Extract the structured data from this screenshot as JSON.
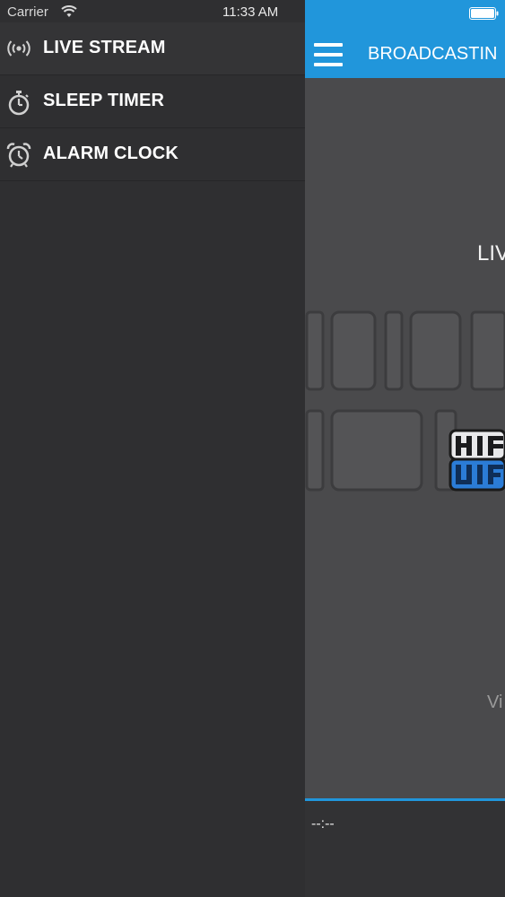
{
  "status_bar": {
    "carrier": "Carrier",
    "time": "11:33 AM"
  },
  "drawer": {
    "items": [
      {
        "label": "LIVE STREAM",
        "icon": "broadcast-icon"
      },
      {
        "label": "SLEEP TIMER",
        "icon": "stopwatch-icon"
      },
      {
        "label": "ALARM CLOCK",
        "icon": "alarm-clock-icon"
      }
    ]
  },
  "header": {
    "title": "BROADCASTIN"
  },
  "main": {
    "live_label": "LIV",
    "bottom_text": "Vi"
  },
  "player": {
    "time": "--:--"
  },
  "colors": {
    "accent": "#2196db",
    "drawer_bg": "#2f2f31",
    "main_bg": "#4a4a4c"
  }
}
